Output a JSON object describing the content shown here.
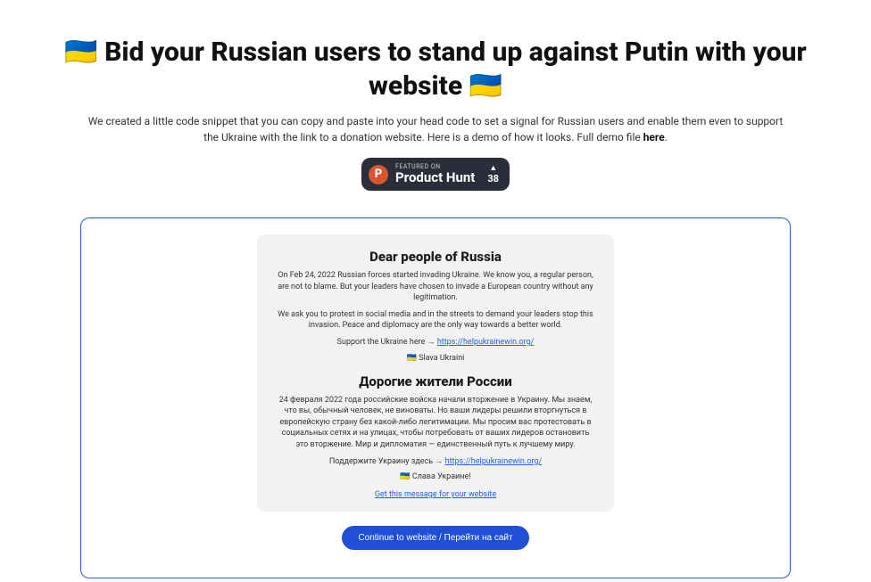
{
  "header": {
    "title_pre_flag": "🇺🇦",
    "title_text": "Bid your Russian users to stand up against Putin with your website",
    "title_post_flag": "🇺🇦",
    "subtitle_pre": "We created a little code snippet that you can copy and paste into your head code to set a signal for Russian users and enable them even to support the Ukraine with the link to a donation website. Here is a demo of how it looks. Full demo file ",
    "subtitle_link": "here",
    "subtitle_post": "."
  },
  "product_hunt": {
    "featured_label": "FEATURED ON",
    "name": "Product Hunt",
    "logo_letter": "P",
    "upvote_count": "38"
  },
  "message": {
    "en": {
      "title": "Dear people of Russia",
      "body1": "On Feb 24, 2022 Russian forces started invading Ukraine. We know you, a regular person, are not to blame. But your leaders have chosen to invade a European country without any legitimation.",
      "body2": "We ask you to protest in social media and in the streets to demand your leaders stop this invasion. Peace and diplomacy are the only way towards a better world.",
      "support_pre": "Support the Ukraine here → ",
      "support_link": "https://helpukrainewin.org/",
      "slava": "🇺🇦 Slava Ukraini"
    },
    "ru": {
      "title": "Дорогие жители России",
      "body1": "24 февраля 2022 года российские войска начали вторжение в Украину. Мы знаем, что вы, обычный человек, не виноваты. Но ваши лидеры решили вторгнуться в европейскую страну без какой-либо легитимации. Мы просим вас протестовать в социальных сетях и на улицах, чтобы потребовать от ваших лидеров остановить это вторжение. Мир и дипломатия — единственный путь к лучшему миру.",
      "support_pre": "Поддержите Украину здесь → ",
      "support_link": "https://helpukrainewin.org/",
      "slava": "🇺🇦 Слава Украине!"
    },
    "footer_link": "Get this message for your website"
  },
  "continue_button": "Continue to website / Перейти на сайт"
}
